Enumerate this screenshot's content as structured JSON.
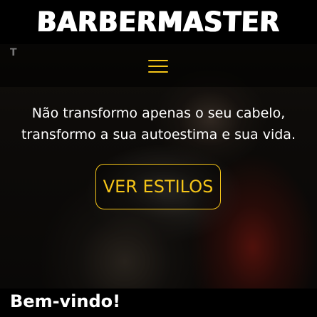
{
  "header": {
    "logo_text": "BARBERMASTER"
  },
  "nav": {
    "menu_icon": "hamburger-menu-icon",
    "corner_mark": "T"
  },
  "hero": {
    "tagline": "Não transformo apenas o seu cabelo, transformo a sua autoestima e sua vida.",
    "cta_label": "VER ESTILOS"
  },
  "section": {
    "title": "Bem-vindo!"
  },
  "colors": {
    "accent": "#f5c518",
    "background": "#000000",
    "text": "#ffffff"
  }
}
